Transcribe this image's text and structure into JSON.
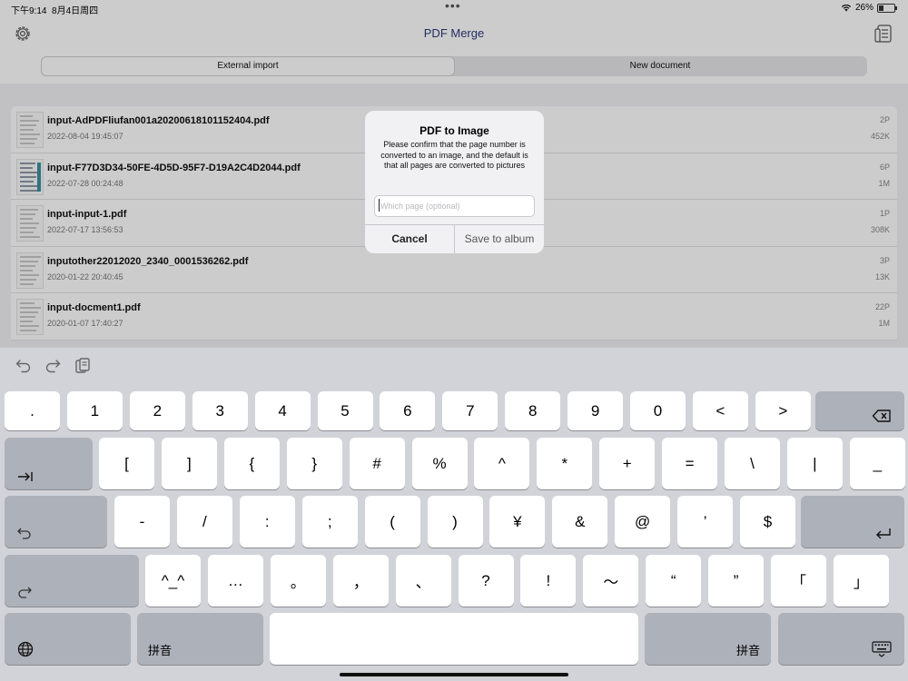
{
  "status": {
    "time": "下午9:14",
    "date": "8月4日周四",
    "battery": "26%"
  },
  "nav": {
    "title": "PDF Merge"
  },
  "tabs": [
    {
      "label": "External import",
      "active": true
    },
    {
      "label": "New document",
      "active": false
    }
  ],
  "files": [
    {
      "name": "input-AdPDFliufan001a20200618101152404.pdf",
      "date": "2022-08-04 19:45:07",
      "pages": "2P",
      "size": "452K",
      "thumb": "light"
    },
    {
      "name": "input-F77D3D34-50FE-4D5D-95F7-D19A2C4D2044.pdf",
      "date": "2022-07-28 00:24:48",
      "pages": "6P",
      "size": "1M",
      "thumb": "dark"
    },
    {
      "name": "input-input-1.pdf",
      "date": "2022-07-17 13:56:53",
      "pages": "1P",
      "size": "308K",
      "thumb": "light"
    },
    {
      "name": "inputother22012020_2340_0001536262.pdf",
      "date": "2020-01-22 20:40:45",
      "pages": "3P",
      "size": "13K",
      "thumb": "light"
    },
    {
      "name": "input-docment1.pdf",
      "date": "2020-01-07 17:40:27",
      "pages": "22P",
      "size": "1M",
      "thumb": "light"
    }
  ],
  "alert": {
    "title": "PDF to Image",
    "message": "Please confirm that the page number is converted to an image, and the default is that all pages are converted to pictures",
    "placeholder": "Which page (optional)",
    "cancel": "Cancel",
    "confirm": "Save to album"
  },
  "keyboard": {
    "row1": [
      ".",
      "1",
      "2",
      "3",
      "4",
      "5",
      "6",
      "7",
      "8",
      "9",
      "0",
      "<",
      ">"
    ],
    "row2": [
      "[",
      "]",
      "{",
      "}",
      "#",
      "%",
      "^",
      "*",
      "+",
      "=",
      "\\",
      "|",
      "_"
    ],
    "row3": [
      "-",
      "/",
      ":",
      ";",
      "(",
      ")",
      "¥",
      "&",
      "@",
      "’",
      "$"
    ],
    "row4": [
      "^_^",
      "…",
      "。",
      "，",
      "、",
      "?",
      "!",
      "～",
      "“",
      "”",
      "「",
      "」"
    ],
    "pinyin_left": "拼音",
    "pinyin_right": "拼音"
  }
}
